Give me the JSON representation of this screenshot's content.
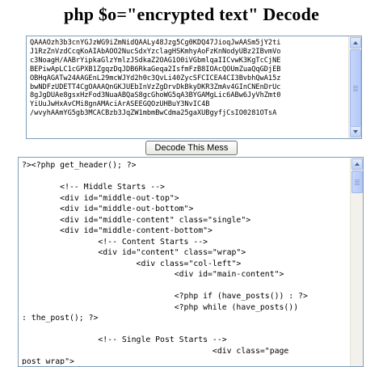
{
  "page": {
    "title": "php $o=\"encrypted text\" Decode"
  },
  "encrypted_input": {
    "value": "QAAAOzh3b3cnYGJzWG9iZmNidQAALy48Jzg5Cg0KDQ47JioqJwAASm5jY2ti\nJ1RzZnVzdCcqKoAIAbAOO2NucSdxYzclagHSKmhyAoFzKnNodyUBz2IBvmVo\nc3NoagH/AABrYipkaGlzYmlzJSdkaZ2OAG1O0iVGbmlqaIICvwK3KgTcCjNE\nBEPiwApLC1cGPXB1ZgqzDqJDB6RkaGeqa2IsfmFzB8IOAcQOUmZuaQqGDjEB\nOBHqAGATw24AAGEnL29mcWJYd2h0c3QvLi40ZycSFCICEA4CI3BvbhQwA15z\nbwNDFzUDETT4CgOAAAQnGKJUEbInVzZgDrvDkBkyDKR3ZmAv4GInCNEnDrUc\n8gJgDUAe8gsxHzFod3NuaABQaS8gcGhoWG5qA3BYGAMgLic6ABw6JyVhZmt0\nYiUuJwHxAvCMi8gnAMAciArASEEGQOzUHBuY3NvIC4B\n/wvyhAAmYG5gb3MCACBzb3JqZW1mbmBwCdma25gaXUBgyfjCsIO0281OTsA"
  },
  "decode_button": {
    "label": "Decode This Mess"
  },
  "decoded_output": {
    "value": "?><?php get_header(); ?>\n\n        <!-- Middle Starts -->\n        <div id=\"middle-out-top\">\n        <div id=\"middle-out-bottom\">\n        <div id=\"middle-content\" class=\"single\">\n        <div id=\"middle-content-bottom\">\n                <!-- Content Starts -->\n                <div id=\"content\" class=\"wrap\">\n                        <div class=\"col-left\">\n                                <div id=\"main-content\">\n\n                                <?php if (have_posts()) : ?>\n                                <?php while (have_posts())\n: the_post(); ?>\n\n                <!-- Single Post Starts -->\n                                        <div class=\"page\npost wrap\">"
  }
}
